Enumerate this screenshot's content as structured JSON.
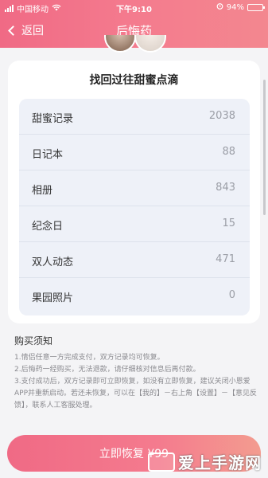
{
  "status_bar": {
    "carrier": "中国移动",
    "time": "下午9:10",
    "battery": "94%",
    "battery_level": 0.94,
    "icons": [
      "signal-icon",
      "wifi-icon",
      "alarm-icon",
      "battery-icon"
    ]
  },
  "navbar": {
    "back_label": "返回",
    "title": "后悔药"
  },
  "card": {
    "title": "找回过往甜蜜点滴",
    "rows": [
      {
        "label": "甜蜜记录",
        "value": "2038"
      },
      {
        "label": "日记本",
        "value": "88"
      },
      {
        "label": "相册",
        "value": "843"
      },
      {
        "label": "纪念日",
        "value": "15"
      },
      {
        "label": "双人动态",
        "value": "471"
      },
      {
        "label": "果园照片",
        "value": "0"
      }
    ]
  },
  "notice": {
    "title": "购买须知",
    "lines": [
      "1.情侣任意一方完成支付，双方记录均可恢复。",
      "2.后悔药一经购买，无法退款，请仔细核对信息后再付款。",
      "3.支付成功后，双方记录即可立即恢复，如没有立即恢复，建议关闭小恩爱APP并重新启动。若还未恢复，可以在【我的】－右上角【设置】－【意见反馈】，联系人工客服处理。"
    ]
  },
  "cta": {
    "label": "立即恢复 ¥99"
  },
  "watermark": {
    "text": "爱上手游网"
  },
  "colors": {
    "brand_pink": "#f06a85",
    "list_bg": "#eef1f8",
    "page_bg": "#f4f4f6"
  }
}
